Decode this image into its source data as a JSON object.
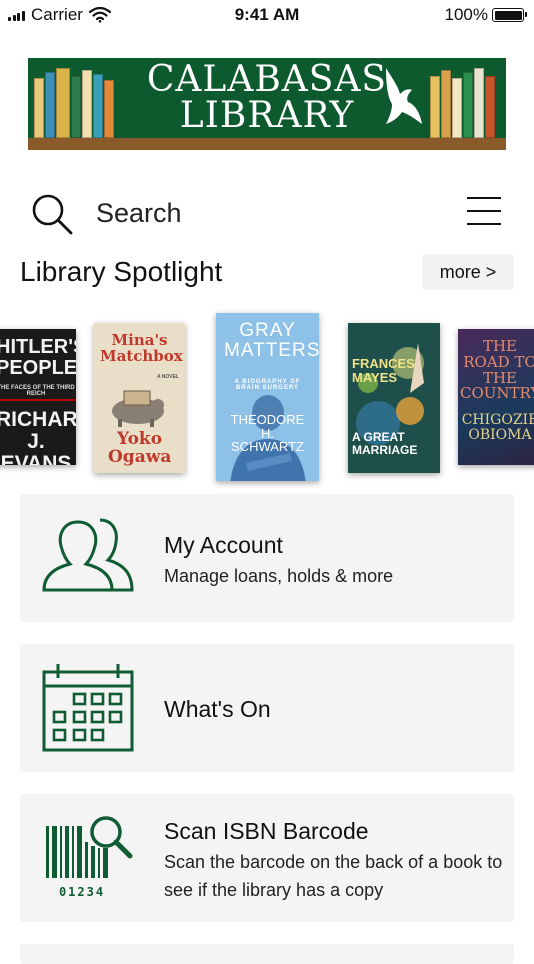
{
  "status_bar": {
    "carrier": "Carrier",
    "time": "9:41 AM",
    "battery": "100%"
  },
  "banner": {
    "line1": "CALABASAS",
    "line2": "LIBRARY"
  },
  "search": {
    "placeholder": "Search"
  },
  "spotlight": {
    "title": "Library Spotlight",
    "more_label": "more >",
    "books": [
      {
        "title": "HITLER'S PEOPLE",
        "subtitle": "THE FACES OF THE THIRD REICH",
        "author": "RICHARD J. EVANS"
      },
      {
        "title": "Mina's Matchbox",
        "subtitle": "A NOVEL",
        "author": "Yoko Ogawa"
      },
      {
        "title": "GRAY MATTERS",
        "subtitle": "A BIOGRAPHY OF BRAIN SURGERY",
        "author": "THEODORE H. SCHWARTZ"
      },
      {
        "title": "A GREAT MARRIAGE",
        "author": "FRANCES MAYES"
      },
      {
        "title": "THE ROAD TO THE COUNTRY",
        "author": "CHIGOZIE OBIOMA"
      }
    ]
  },
  "menu_cards": [
    {
      "title": "My Account",
      "subtitle": "Manage loans, holds & more",
      "icon": "users-icon"
    },
    {
      "title": "What's On",
      "icon": "calendar-icon"
    },
    {
      "title": "Scan ISBN Barcode",
      "subtitle": "Scan the barcode on the back of a book to see if the library has a copy",
      "icon": "barcode-search-icon",
      "barcode_digits": "01234"
    }
  ],
  "colors": {
    "brand_green": "#0d5a2f",
    "icon_green": "#0f5b33",
    "shelf_brown": "#8b5a2b",
    "card_bg": "#f4f4f4"
  }
}
